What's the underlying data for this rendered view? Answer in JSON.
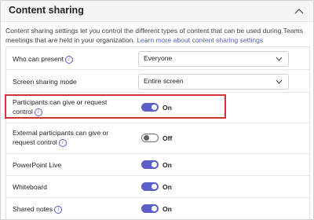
{
  "section": {
    "title": "Content sharing",
    "collapse_icon": "chevron-up-icon",
    "description": "Content sharing settings let you control the different types of content that can be used during Teams meetings that are held in your organization.",
    "learn_more": "Learn more about content sharing settings"
  },
  "settings": {
    "who_can_present": {
      "label": "Who can present",
      "value": "Everyone"
    },
    "screen_sharing_mode": {
      "label": "Screen sharing mode",
      "value": "Entire screen"
    },
    "participants_control": {
      "label_line1": "Participants can give or request",
      "label_line2": "control",
      "state": "On"
    },
    "external_control": {
      "label_line1": "External participants can give or",
      "label_line2": "request control",
      "state": "Off"
    },
    "powerpoint_live": {
      "label": "PowerPoint Live",
      "state": "On"
    },
    "whiteboard": {
      "label": "Whiteboard",
      "state": "On"
    },
    "shared_notes": {
      "label": "Shared notes",
      "state": "On"
    }
  },
  "info_glyph": "i",
  "colors": {
    "accent": "#5b5fc7",
    "highlight": "#d13438"
  }
}
